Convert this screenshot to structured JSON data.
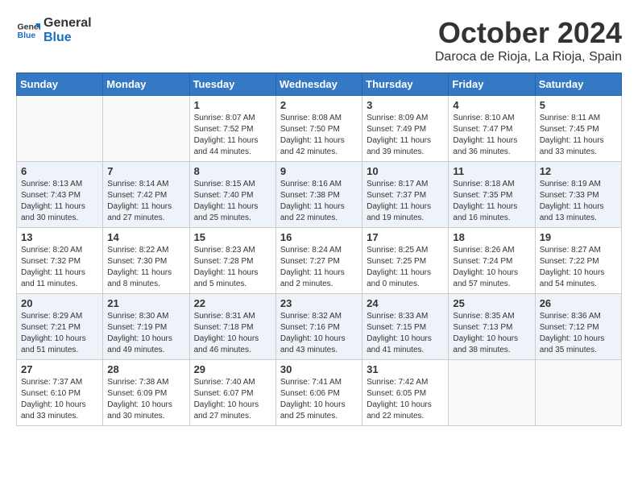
{
  "header": {
    "logo_line1": "General",
    "logo_line2": "Blue",
    "month": "October 2024",
    "location": "Daroca de Rioja, La Rioja, Spain"
  },
  "weekdays": [
    "Sunday",
    "Monday",
    "Tuesday",
    "Wednesday",
    "Thursday",
    "Friday",
    "Saturday"
  ],
  "weeks": [
    [
      {
        "day": "",
        "info": ""
      },
      {
        "day": "",
        "info": ""
      },
      {
        "day": "1",
        "info": "Sunrise: 8:07 AM\nSunset: 7:52 PM\nDaylight: 11 hours and 44 minutes."
      },
      {
        "day": "2",
        "info": "Sunrise: 8:08 AM\nSunset: 7:50 PM\nDaylight: 11 hours and 42 minutes."
      },
      {
        "day": "3",
        "info": "Sunrise: 8:09 AM\nSunset: 7:49 PM\nDaylight: 11 hours and 39 minutes."
      },
      {
        "day": "4",
        "info": "Sunrise: 8:10 AM\nSunset: 7:47 PM\nDaylight: 11 hours and 36 minutes."
      },
      {
        "day": "5",
        "info": "Sunrise: 8:11 AM\nSunset: 7:45 PM\nDaylight: 11 hours and 33 minutes."
      }
    ],
    [
      {
        "day": "6",
        "info": "Sunrise: 8:13 AM\nSunset: 7:43 PM\nDaylight: 11 hours and 30 minutes."
      },
      {
        "day": "7",
        "info": "Sunrise: 8:14 AM\nSunset: 7:42 PM\nDaylight: 11 hours and 27 minutes."
      },
      {
        "day": "8",
        "info": "Sunrise: 8:15 AM\nSunset: 7:40 PM\nDaylight: 11 hours and 25 minutes."
      },
      {
        "day": "9",
        "info": "Sunrise: 8:16 AM\nSunset: 7:38 PM\nDaylight: 11 hours and 22 minutes."
      },
      {
        "day": "10",
        "info": "Sunrise: 8:17 AM\nSunset: 7:37 PM\nDaylight: 11 hours and 19 minutes."
      },
      {
        "day": "11",
        "info": "Sunrise: 8:18 AM\nSunset: 7:35 PM\nDaylight: 11 hours and 16 minutes."
      },
      {
        "day": "12",
        "info": "Sunrise: 8:19 AM\nSunset: 7:33 PM\nDaylight: 11 hours and 13 minutes."
      }
    ],
    [
      {
        "day": "13",
        "info": "Sunrise: 8:20 AM\nSunset: 7:32 PM\nDaylight: 11 hours and 11 minutes."
      },
      {
        "day": "14",
        "info": "Sunrise: 8:22 AM\nSunset: 7:30 PM\nDaylight: 11 hours and 8 minutes."
      },
      {
        "day": "15",
        "info": "Sunrise: 8:23 AM\nSunset: 7:28 PM\nDaylight: 11 hours and 5 minutes."
      },
      {
        "day": "16",
        "info": "Sunrise: 8:24 AM\nSunset: 7:27 PM\nDaylight: 11 hours and 2 minutes."
      },
      {
        "day": "17",
        "info": "Sunrise: 8:25 AM\nSunset: 7:25 PM\nDaylight: 11 hours and 0 minutes."
      },
      {
        "day": "18",
        "info": "Sunrise: 8:26 AM\nSunset: 7:24 PM\nDaylight: 10 hours and 57 minutes."
      },
      {
        "day": "19",
        "info": "Sunrise: 8:27 AM\nSunset: 7:22 PM\nDaylight: 10 hours and 54 minutes."
      }
    ],
    [
      {
        "day": "20",
        "info": "Sunrise: 8:29 AM\nSunset: 7:21 PM\nDaylight: 10 hours and 51 minutes."
      },
      {
        "day": "21",
        "info": "Sunrise: 8:30 AM\nSunset: 7:19 PM\nDaylight: 10 hours and 49 minutes."
      },
      {
        "day": "22",
        "info": "Sunrise: 8:31 AM\nSunset: 7:18 PM\nDaylight: 10 hours and 46 minutes."
      },
      {
        "day": "23",
        "info": "Sunrise: 8:32 AM\nSunset: 7:16 PM\nDaylight: 10 hours and 43 minutes."
      },
      {
        "day": "24",
        "info": "Sunrise: 8:33 AM\nSunset: 7:15 PM\nDaylight: 10 hours and 41 minutes."
      },
      {
        "day": "25",
        "info": "Sunrise: 8:35 AM\nSunset: 7:13 PM\nDaylight: 10 hours and 38 minutes."
      },
      {
        "day": "26",
        "info": "Sunrise: 8:36 AM\nSunset: 7:12 PM\nDaylight: 10 hours and 35 minutes."
      }
    ],
    [
      {
        "day": "27",
        "info": "Sunrise: 7:37 AM\nSunset: 6:10 PM\nDaylight: 10 hours and 33 minutes."
      },
      {
        "day": "28",
        "info": "Sunrise: 7:38 AM\nSunset: 6:09 PM\nDaylight: 10 hours and 30 minutes."
      },
      {
        "day": "29",
        "info": "Sunrise: 7:40 AM\nSunset: 6:07 PM\nDaylight: 10 hours and 27 minutes."
      },
      {
        "day": "30",
        "info": "Sunrise: 7:41 AM\nSunset: 6:06 PM\nDaylight: 10 hours and 25 minutes."
      },
      {
        "day": "31",
        "info": "Sunrise: 7:42 AM\nSunset: 6:05 PM\nDaylight: 10 hours and 22 minutes."
      },
      {
        "day": "",
        "info": ""
      },
      {
        "day": "",
        "info": ""
      }
    ]
  ]
}
